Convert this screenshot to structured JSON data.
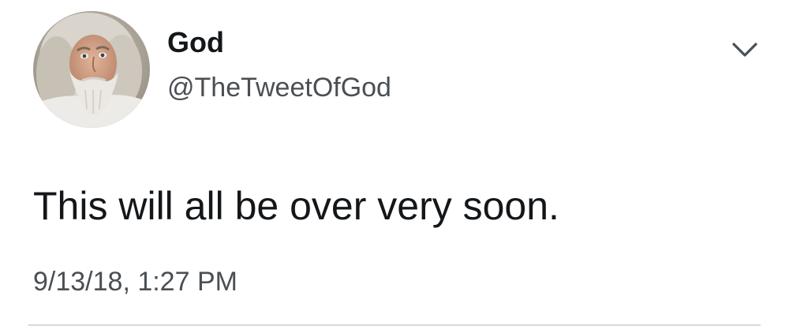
{
  "tweet": {
    "author": {
      "display_name": "God",
      "handle": "@TheTweetOfGod",
      "avatar": "bearded-man-avatar"
    },
    "text": "This will all be over very soon.",
    "timestamp": "9/13/18, 1:27 PM",
    "menu_icon": "chevron-down-icon"
  },
  "colors": {
    "text_primary": "#14171a",
    "text_secondary": "#4a4f54",
    "divider": "#d6dadd"
  }
}
